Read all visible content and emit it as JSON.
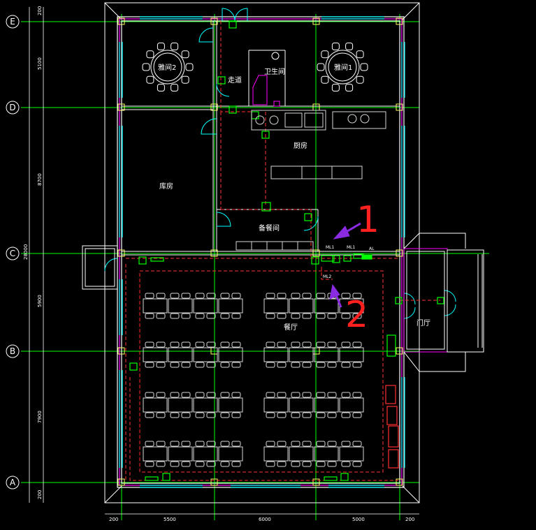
{
  "colors": {
    "background": "#000000",
    "wall": "#ffffff",
    "column": "#ffff66",
    "grid": "#00ff00",
    "dim": "#ffffff",
    "window": "#00ffff",
    "pink": "#ff00ff",
    "red_dash": "#ff3030",
    "device": "#00ff00",
    "arrow": "#8a2be2",
    "handwriting": "#ff2020",
    "furniture": "#d8d8d8",
    "label": "#ffffff"
  },
  "grid_axes": {
    "rows": [
      {
        "label": "E"
      },
      {
        "label": "D"
      },
      {
        "label": "C"
      },
      {
        "label": "B"
      },
      {
        "label": "A"
      }
    ]
  },
  "dimensions": {
    "left": [
      "200",
      "5100",
      "8700",
      "28000",
      "5900",
      "7900",
      "200"
    ],
    "bottom": [
      "200",
      "5500",
      "6000",
      "5000",
      "200"
    ]
  },
  "rooms": [
    {
      "label": "雅间2"
    },
    {
      "label": "雅间1"
    },
    {
      "label": "走道"
    },
    {
      "label": "卫生间"
    },
    {
      "label": "厨房"
    },
    {
      "label": "库房"
    },
    {
      "label": "备餐间"
    },
    {
      "label": "餐厅"
    },
    {
      "label": "门厅"
    }
  ],
  "equipment_labels": [
    "ML1",
    "ML1",
    "AL",
    "ML2"
  ],
  "annotations": {
    "mark_1": "1",
    "mark_2": "2"
  }
}
